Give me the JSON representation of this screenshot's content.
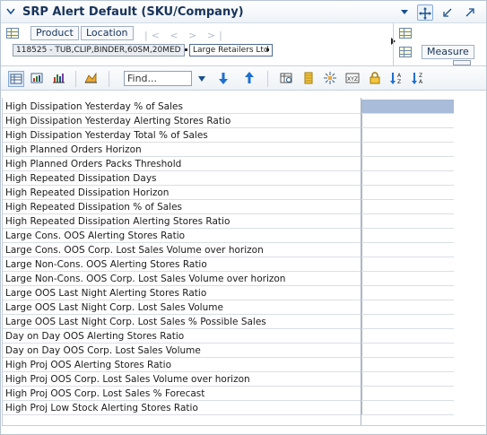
{
  "window": {
    "title": "SRP Alert Default (SKU/Company)"
  },
  "dimensions": {
    "product_label": "Product",
    "location_label": "Location",
    "product_chip": "118525 - TUB,CLIP,BINDER,60SM,20MED",
    "location_chip": "Large Retailers Ltd",
    "measure_label": "Measure",
    "nav_glyphs": "|< < > >|"
  },
  "toolbar": {
    "find_placeholder": "Find..."
  },
  "table": {
    "rows": [
      "High Dissipation Yesterday % of Sales",
      "High Dissipation Yesterday Alerting Stores Ratio",
      "High Dissipation Yesterday Total % of Sales",
      "High Planned Orders Horizon",
      "High Planned Orders Packs Threshold",
      "High Repeated Dissipation Days",
      "High Repeated Dissipation Horizon",
      "High Repeated Dissipation % of Sales",
      "High Repeated Dissipation Alerting Stores Ratio",
      "Large Cons. OOS Alerting Stores Ratio",
      "Large Cons. OOS Corp. Lost Sales Volume over horizon",
      "Large Non-Cons. OOS Alerting Stores Ratio",
      "Large Non-Cons. OOS Corp. Lost Sales Volume over horizon",
      "Large OOS Last Night Alerting Stores Ratio",
      "Large OOS Last Night Corp. Lost Sales Volume",
      "Large OOS Last Night Corp. Lost Sales % Possible Sales",
      "Day on Day OOS Alerting Stores Ratio",
      "Day on Day OOS Corp. Lost Sales Volume",
      "High Proj OOS Alerting Stores Ratio",
      "High Proj OOS Corp. Lost Sales Volume over horizon",
      "High Proj OOS Corp. Lost Sales % Forecast",
      "High Proj Low Stock Alerting Stores Ratio"
    ]
  },
  "colors": {
    "title": "#17335a",
    "selected_cell": "#a9bcd9",
    "accent": "#1a4f8b"
  }
}
